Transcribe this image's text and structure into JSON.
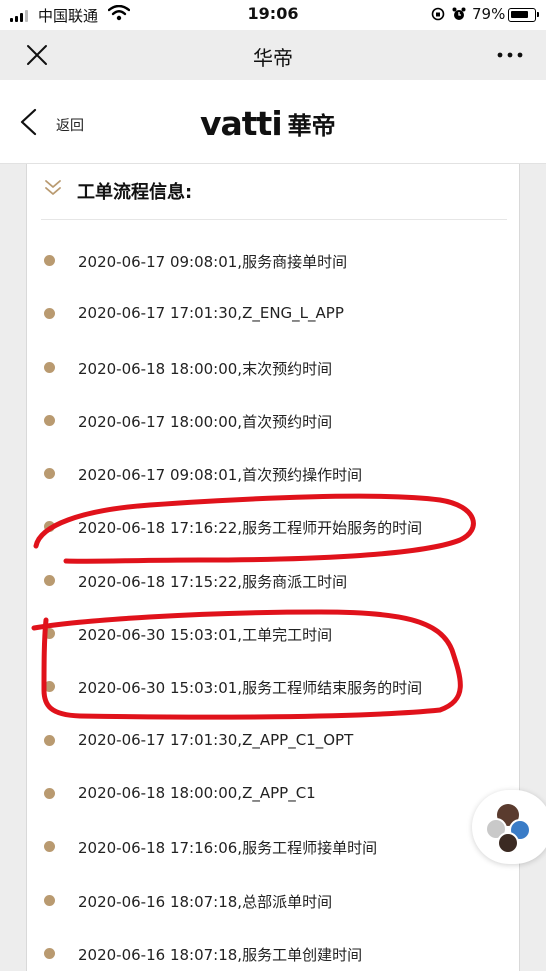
{
  "status_bar": {
    "carrier": "中国联通",
    "time": "19:06",
    "battery_percent": "79%"
  },
  "wechat_header": {
    "title": "华帝",
    "close_icon": "close-icon",
    "more_icon": "more-icon"
  },
  "vatti_header": {
    "back_label": "返回",
    "logo_latin": "vatti",
    "logo_cjk": "華帝"
  },
  "section": {
    "title": "工单流程信息:",
    "items": [
      "2020-06-17 09:08:01,服务商接单时间",
      "2020-06-17 17:01:30,Z_ENG_L_APP",
      "2020-06-18 18:00:00,末次预约时间",
      "2020-06-17 18:00:00,首次预约时间",
      "2020-06-17 09:08:01,首次预约操作时间",
      "2020-06-18 17:16:22,服务工程师开始服务的时间",
      "2020-06-18 17:15:22,服务商派工时间",
      "2020-06-30 15:03:01,工单完工时间",
      "2020-06-30 15:03:01,服务工程师结束服务的时间",
      "2020-06-17 17:01:30,Z_APP_C1_OPT",
      "2020-06-18 18:00:00,Z_APP_C1",
      "2020-06-18 17:16:06,服务工程师接单时间",
      "2020-06-16 18:07:18,总部派单时间",
      "2020-06-16 18:07:18,服务工单创建时间"
    ]
  },
  "colors": {
    "timeline_dot": "#b99a70",
    "annotation_red": "#e0121b"
  }
}
